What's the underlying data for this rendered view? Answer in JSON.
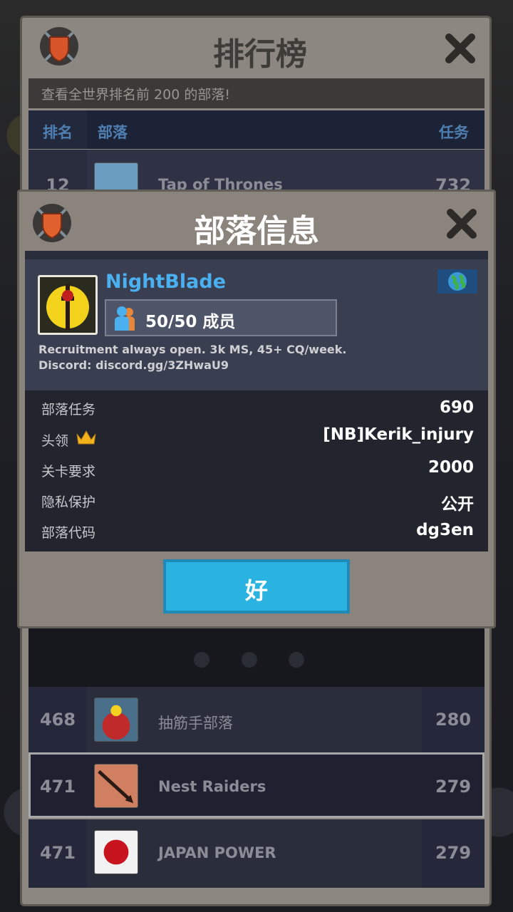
{
  "leaderboard": {
    "title": "排行榜",
    "subtitle": "查看全世界排名前 200 的部落!",
    "columns": {
      "rank": "排名",
      "clan": "部落",
      "quests": "任务"
    },
    "top_row": {
      "rank": "12",
      "name": "Tap of Thrones",
      "score": "732"
    },
    "rows": [
      {
        "rank": "468",
        "name": "抽筋手部落",
        "score": "280"
      },
      {
        "rank": "471",
        "name": "Nest Raiders",
        "score": "279"
      },
      {
        "rank": "471",
        "name": "JAPAN  POWER",
        "score": "279"
      }
    ]
  },
  "modal": {
    "title": "部落信息",
    "clan_name": "NightBlade",
    "members": "50/50 成员",
    "description_line1": "Recruitment always open. 3k MS, 45+ CQ/week.",
    "description_line2": "Discord: discord.gg/3ZHwaU9",
    "stats": [
      {
        "label": "部落任务",
        "value": "690"
      },
      {
        "label": "头领",
        "value": "[NB]Kerik_injury"
      },
      {
        "label": "关卡要求",
        "value": "2000"
      },
      {
        "label": "隐私保护",
        "value": "公开"
      },
      {
        "label": "部落代码",
        "value": "dg3en"
      }
    ],
    "ok_label": "好"
  },
  "icons": [
    "shield-icon",
    "close-icon",
    "members-icon",
    "globe-flag-icon",
    "crown-icon"
  ],
  "colors": {
    "clan_name": "#4ab0f0",
    "ok_button": "#2ab3e0",
    "panel": "#8a847c"
  }
}
